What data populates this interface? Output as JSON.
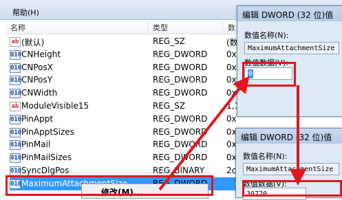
{
  "menubar": {
    "help": "帮助(H)"
  },
  "list": {
    "columns": {
      "name": "名称",
      "type": "类型",
      "data": "数"
    },
    "rows": [
      {
        "icon": "ab",
        "name": "(默认)",
        "type": "REG_SZ",
        "data": "(数"
      },
      {
        "icon": "dw",
        "name": "CNHeight",
        "type": "REG_DWORD",
        "data": "0x"
      },
      {
        "icon": "dw",
        "name": "CNPosX",
        "type": "REG_DWORD",
        "data": "0x"
      },
      {
        "icon": "dw",
        "name": "CNPosY",
        "type": "REG_DWORD",
        "data": "0x"
      },
      {
        "icon": "dw",
        "name": "CNWidth",
        "type": "REG_DWORD",
        "data": "0x"
      },
      {
        "icon": "ab",
        "name": "ModuleVisible15",
        "type": "REG_SZ",
        "data": "1,1"
      },
      {
        "icon": "dw",
        "name": "PinAppt",
        "type": "REG_DWORD",
        "data": "0x"
      },
      {
        "icon": "dw",
        "name": "PinApptSizes",
        "type": "REG_DWORD",
        "data": "0x"
      },
      {
        "icon": "dw",
        "name": "PinMail",
        "type": "REG_DWORD",
        "data": "0x"
      },
      {
        "icon": "dw",
        "name": "PinMailSizes",
        "type": "REG_DWORD",
        "data": "0x"
      },
      {
        "icon": "dw",
        "name": "SyncDlgPos",
        "type": "REG_BINARY",
        "data": "2c"
      },
      {
        "icon": "dw",
        "name": "MaximumAttachmentSize",
        "type": "REG_DWORD",
        "data": ""
      }
    ],
    "icon_glyphs": {
      "ab": "ab",
      "dw": "010"
    }
  },
  "context_menu": {
    "modify": "修改(M)..."
  },
  "dialog_top": {
    "title": "编辑 DWORD (32 位)值",
    "value_name_label": "数值名称(N):",
    "value_name": "MaximumAttachmentSize",
    "value_data_label": "数值数据(V):",
    "value_data": "0"
  },
  "dialog_bottom": {
    "title": "编辑 DWORD (32 位)值",
    "value_name_label": "数值名称(N):",
    "value_name": "MaximumAttachmentSize",
    "value_data_label": "数值数据(V):",
    "value_data": "30720"
  },
  "colors": {
    "highlight": "#e3141c",
    "selection": "#3399ff"
  }
}
